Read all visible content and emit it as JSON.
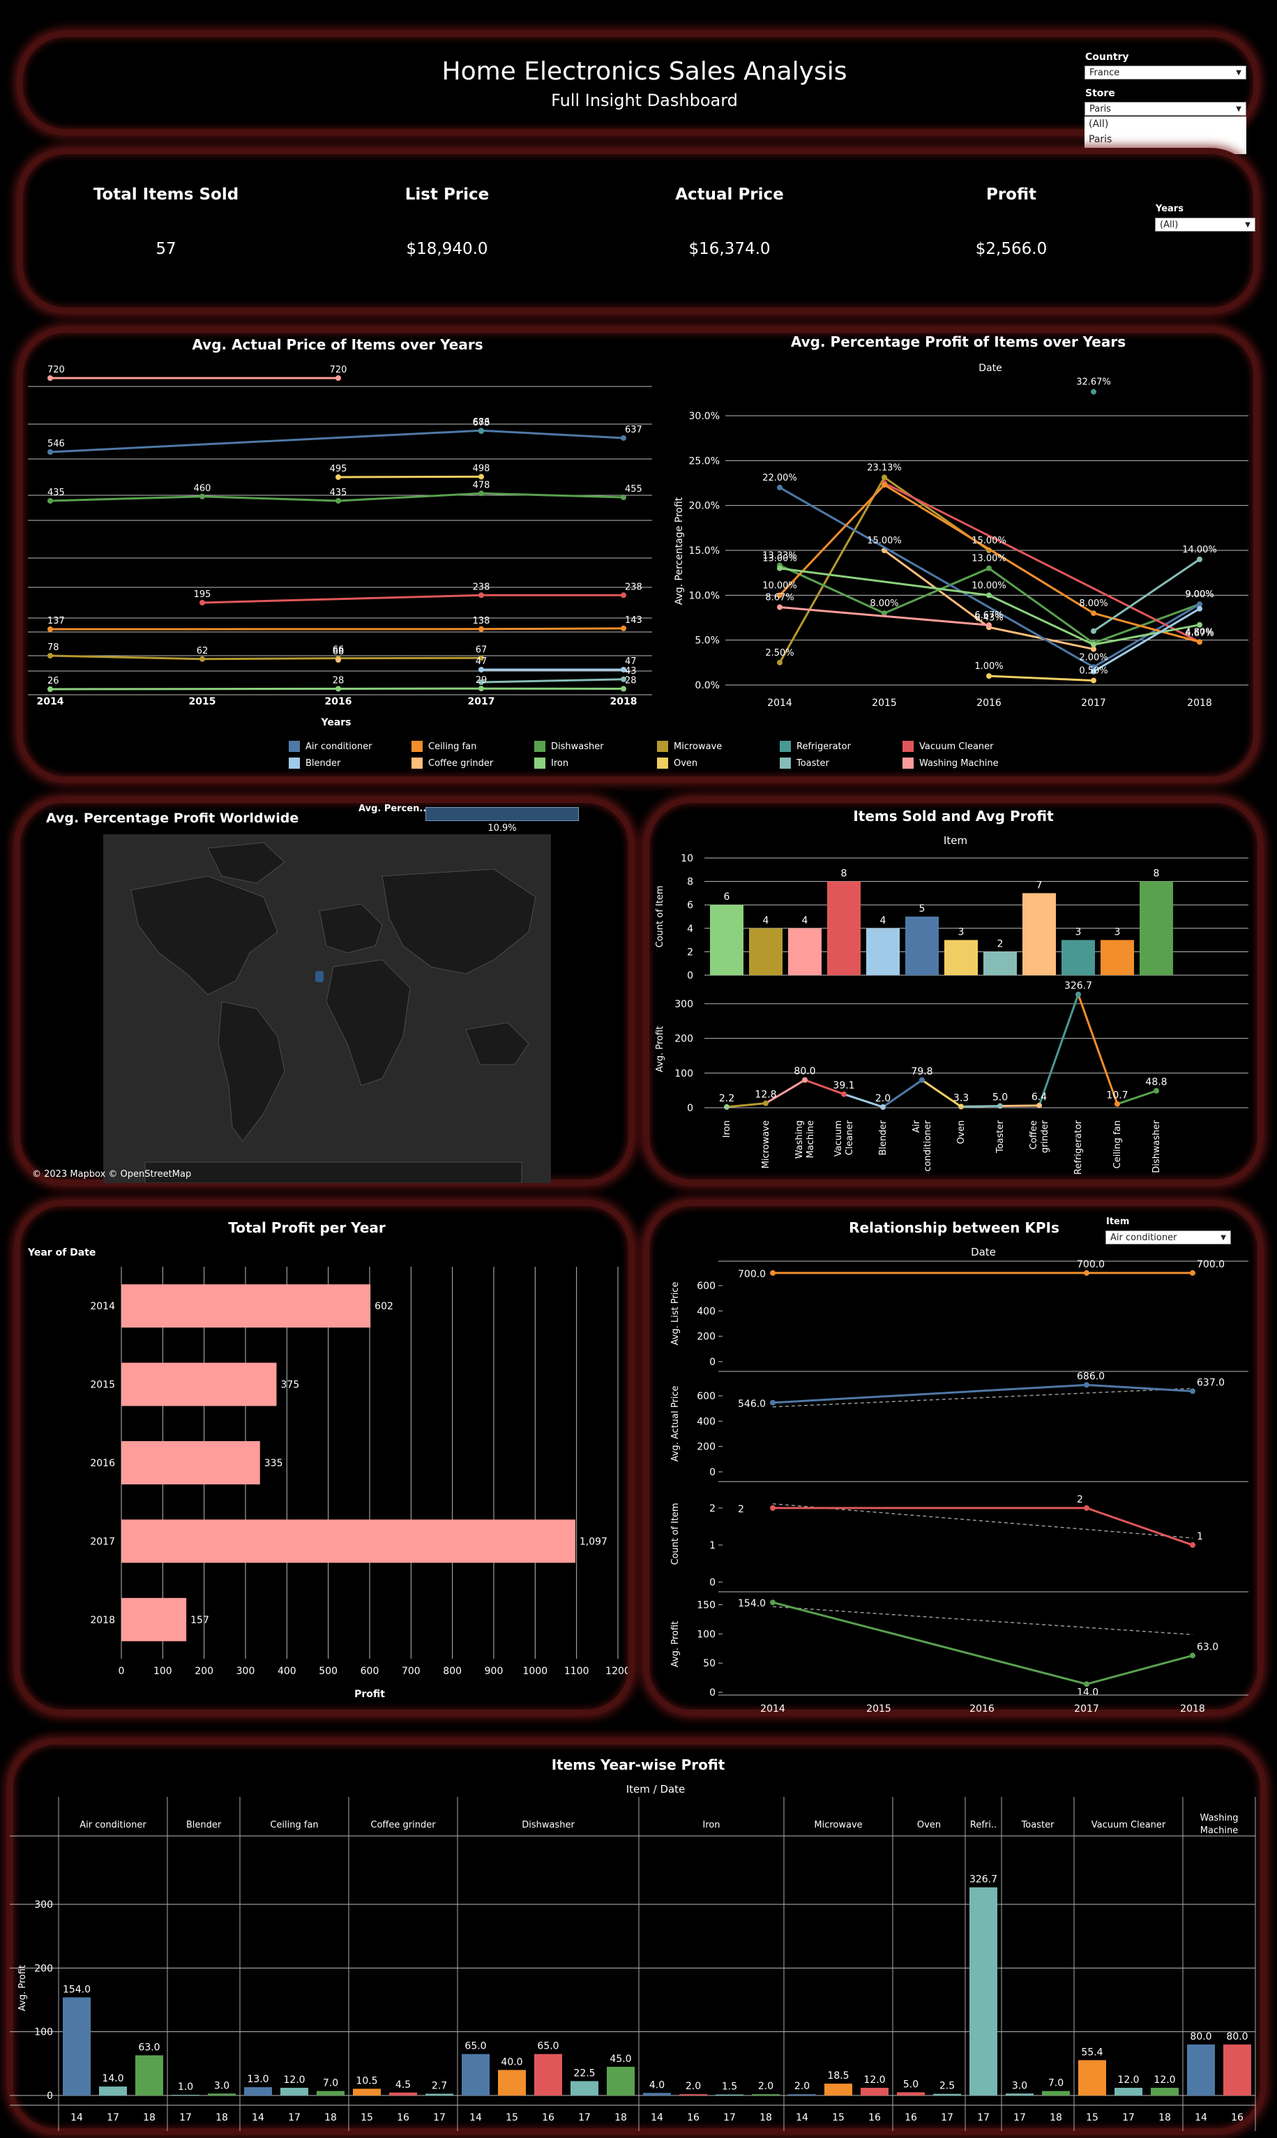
{
  "header": {
    "title": "Home Electronics Sales Analysis",
    "subtitle": "Full Insight Dashboard"
  },
  "filters": {
    "country_label": "Country",
    "country_value": "France",
    "store_label": "Store",
    "store_value": "Paris",
    "store_options": [
      "(All)",
      "Paris"
    ],
    "years_label": "Years",
    "years_value": "(All)"
  },
  "kpis": [
    {
      "label": "Total Items Sold",
      "value": "57"
    },
    {
      "label": "List Price",
      "value": "$18,940.0"
    },
    {
      "label": "Actual Price",
      "value": "$16,374.0"
    },
    {
      "label": "Profit",
      "value": "$2,566.0"
    }
  ],
  "colors": {
    "Air conditioner": "#4e79a7",
    "Blender": "#a0cbe8",
    "Ceiling fan": "#f28e2b",
    "Coffee grinder": "#ffbe7d",
    "Dishwasher": "#59a14f",
    "Iron": "#8cd17d",
    "Microwave": "#b6992d",
    "Oven": "#f1ce63",
    "Refrigerator": "#499894",
    "Toaster": "#86bcb6",
    "Vacuum Cleaner": "#e15759",
    "Washing Machine": "#ff9d9a",
    "panel_border": "#4a1010",
    "bar_pink": "#ff9d9a"
  },
  "legend": [
    "Air conditioner",
    "Ceiling fan",
    "Dishwasher",
    "Microwave",
    "Refrigerator",
    "Vacuum Cleaner",
    "Blender",
    "Coffee grinder",
    "Iron",
    "Oven",
    "Toaster",
    "Washing Machine"
  ],
  "avg_price_chart": {
    "title": "Avg. Actual Price of Items over Years",
    "xlabel": "Years",
    "years": [
      "2014",
      "2015",
      "2016",
      "2017",
      "2018"
    ],
    "series": [
      {
        "name": "Washing Machine",
        "values": [
          720,
          null,
          720,
          null,
          null
        ],
        "labels": [
          "720",
          "",
          "720",
          "",
          ""
        ]
      },
      {
        "name": "Air conditioner",
        "values": [
          546,
          null,
          null,
          686,
          637
        ],
        "labels": [
          "546",
          "",
          "",
          "686",
          "637"
        ]
      },
      {
        "name": "Refrigerator",
        "values": [
          null,
          null,
          null,
          673,
          null
        ],
        "labels": [
          "",
          "",
          "",
          "673",
          ""
        ]
      },
      {
        "name": "Oven",
        "values": [
          null,
          null,
          495,
          498,
          null
        ],
        "labels": [
          "",
          "",
          "495",
          "498",
          ""
        ]
      },
      {
        "name": "Dishwasher",
        "values": [
          435,
          460,
          435,
          478,
          455
        ],
        "labels": [
          "435",
          "460",
          "435",
          "478",
          "455"
        ]
      },
      {
        "name": "Vacuum Cleaner",
        "values": [
          null,
          195,
          null,
          238,
          238
        ],
        "labels": [
          "",
          "195",
          "",
          "238",
          "238"
        ]
      },
      {
        "name": "Ceiling fan",
        "values": [
          137,
          null,
          null,
          138,
          143
        ],
        "labels": [
          "137",
          "",
          "",
          "138",
          "143"
        ]
      },
      {
        "name": "Microwave",
        "values": [
          78,
          62,
          66,
          67,
          null
        ],
        "labels": [
          "78",
          "62",
          "66",
          "67",
          ""
        ]
      },
      {
        "name": "Coffee grinder",
        "values": [
          null,
          null,
          68,
          null,
          null
        ],
        "labels": [
          "",
          "",
          "68",
          "",
          ""
        ]
      },
      {
        "name": "Blender",
        "values": [
          null,
          null,
          null,
          47,
          47
        ],
        "labels": [
          "",
          "",
          "",
          "47",
          "47"
        ]
      },
      {
        "name": "Toaster",
        "values": [
          null,
          null,
          null,
          29,
          43
        ],
        "labels": [
          "",
          "",
          "",
          "",
          "43"
        ]
      },
      {
        "name": "Iron",
        "values": [
          26,
          null,
          28,
          29,
          28
        ],
        "labels": [
          "26",
          "",
          "28",
          "29",
          "28"
        ]
      }
    ]
  },
  "pct_profit_chart": {
    "title": "Avg. Percentage Profit of Items over Years",
    "header": "Date",
    "ylabel": "Avg. Percentage Profit",
    "yticks": [
      "0.0%",
      "5.0%",
      "10.0%",
      "15.0%",
      "20.0%",
      "25.0%",
      "30.0%"
    ],
    "years": [
      "2014",
      "2015",
      "2016",
      "2017",
      "2018"
    ],
    "series": [
      {
        "name": "Microwave",
        "values": [
          2.5,
          23.13,
          15.0,
          null,
          null
        ]
      },
      {
        "name": "Coffee grinder",
        "values": [
          null,
          15.0,
          6.43,
          4.0,
          null
        ]
      },
      {
        "name": "Dishwasher",
        "values": [
          13.33,
          8.0,
          13.0,
          4.67,
          9.0
        ]
      },
      {
        "name": "Oven",
        "values": [
          null,
          null,
          1.0,
          0.5,
          null
        ]
      },
      {
        "name": "Air conditioner",
        "values": [
          22.0,
          null,
          null,
          2.0,
          9.0
        ]
      },
      {
        "name": "Vacuum Cleaner",
        "values": [
          null,
          22.5,
          null,
          null,
          4.8
        ]
      },
      {
        "name": "Ceiling fan",
        "values": [
          10.0,
          22.3,
          null,
          8.0,
          4.8
        ]
      },
      {
        "name": "Iron",
        "values": [
          13.0,
          null,
          10.0,
          4.5,
          6.7
        ]
      },
      {
        "name": "Toaster",
        "values": [
          null,
          null,
          null,
          6.0,
          14.0
        ]
      },
      {
        "name": "Refrigerator",
        "values": [
          null,
          null,
          null,
          32.67,
          null
        ]
      },
      {
        "name": "Washing Machine",
        "values": [
          8.67,
          null,
          6.67,
          null,
          null
        ]
      },
      {
        "name": "Blender",
        "values": [
          null,
          null,
          null,
          1.5,
          8.5
        ]
      }
    ],
    "labels": [
      {
        "text": "32.67%",
        "x": "2017",
        "y": 32.67
      },
      {
        "text": "22.00%",
        "x": "2014",
        "y": 22.0
      },
      {
        "text": "23.13%",
        "x": "2015",
        "y": 23.13
      },
      {
        "text": "15.00%",
        "x": "2015",
        "y": 15.0
      },
      {
        "text": "15.00%",
        "x": "2016",
        "y": 15.0
      },
      {
        "text": "14.00%",
        "x": "2018",
        "y": 14.0
      },
      {
        "text": "13.33%",
        "x": "2014",
        "y": 13.33
      },
      {
        "text": "13.00%",
        "x": "2014",
        "y": 13.0
      },
      {
        "text": "13.00%",
        "x": "2016",
        "y": 13.0
      },
      {
        "text": "10.00%",
        "x": "2014",
        "y": 10.0
      },
      {
        "text": "10.00%",
        "x": "2016",
        "y": 10.0
      },
      {
        "text": "8.67%",
        "x": "2014",
        "y": 8.67
      },
      {
        "text": "8.00%",
        "x": "2015",
        "y": 8.0
      },
      {
        "text": "8.00%",
        "x": "2017",
        "y": 8.0
      },
      {
        "text": "9.00%",
        "x": "2018",
        "y": 9.0
      },
      {
        "text": "9.00%",
        "x": "2018",
        "y": 9.0
      },
      {
        "text": "6.67%",
        "x": "2016",
        "y": 6.67
      },
      {
        "text": "6.43%",
        "x": "2016",
        "y": 6.43
      },
      {
        "text": "4.67%",
        "x": "2018",
        "y": 4.67
      },
      {
        "text": "4.80%",
        "x": "2018",
        "y": 4.8
      },
      {
        "text": "2.50%",
        "x": "2014",
        "y": 2.5
      },
      {
        "text": "2.00%",
        "x": "2017",
        "y": 2.0
      },
      {
        "text": "1.00%",
        "x": "2016",
        "y": 1.0
      },
      {
        "text": "0.50%",
        "x": "2017",
        "y": 0.5
      }
    ]
  },
  "map_panel": {
    "title": "Avg. Percentage Profit Worldwide",
    "legend_label": "Avg. Percen...",
    "legend_value": "10.9%",
    "attribution": "© 2023 Mapbox  © OpenStreetMap"
  },
  "items_sold_chart": {
    "title": "Items Sold and Avg Profit",
    "header": "Item",
    "ylabel_top": "Count of Item",
    "ylabel_bottom": "Avg. Profit",
    "items": [
      "Iron",
      "Microwave",
      "Washing Machine",
      "Vacuum Cleaner",
      "Blender",
      "Air conditioner",
      "Oven",
      "Toaster",
      "Coffee grinder",
      "Refrigerator",
      "Ceiling fan",
      "Dishwasher"
    ],
    "item_labels": [
      [
        "Iron"
      ],
      [
        "Microwave"
      ],
      [
        "Washing",
        "Machine"
      ],
      [
        "Vacuum",
        "Cleaner"
      ],
      [
        "Blender"
      ],
      [
        "Air",
        "conditioner"
      ],
      [
        "Oven"
      ],
      [
        "Toaster"
      ],
      [
        "Coffee",
        "grinder"
      ],
      [
        "Refrigerator"
      ],
      [
        "Ceiling fan"
      ],
      [
        "Dishwasher"
      ]
    ],
    "counts": [
      6,
      4,
      4,
      8,
      4,
      5,
      3,
      2,
      7,
      3,
      3,
      8
    ],
    "count_ticks": [
      "0",
      "2",
      "4",
      "6",
      "8",
      "10"
    ],
    "profits": [
      2.2,
      12.8,
      80.0,
      39.1,
      2.0,
      79.8,
      3.3,
      5.0,
      6.4,
      326.7,
      10.7,
      48.8
    ],
    "profit_labels": [
      "2.2",
      "12.8",
      "80.0",
      "39.1",
      "2.0",
      "79.8",
      "3.3",
      "5.0",
      "6.4",
      "326.7",
      "10.7",
      "48.8"
    ],
    "profit_ticks": [
      "0",
      "100",
      "200",
      "300"
    ]
  },
  "profit_year_chart": {
    "title": "Total Profit per Year",
    "row_header": "Year of Date",
    "xlabel": "Profit",
    "years": [
      "2014",
      "2015",
      "2016",
      "2017",
      "2018"
    ],
    "values": [
      602,
      375,
      335,
      1097,
      157
    ],
    "labels": [
      "602",
      "375",
      "335",
      "1,097",
      "157"
    ],
    "xticks": [
      "0",
      "100",
      "200",
      "300",
      "400",
      "500",
      "600",
      "700",
      "800",
      "900",
      "1000",
      "1100",
      "1200"
    ]
  },
  "kpi_relation_chart": {
    "title": "Relationship between KPIs",
    "header": "Date",
    "item_label": "Item",
    "item_value": "Air conditioner",
    "years": [
      "2014",
      "2015",
      "2016",
      "2017",
      "2018"
    ],
    "panes": [
      {
        "ylabel": "Avg. List Price",
        "ticks": [
          "0",
          "200",
          "400",
          "600"
        ],
        "max": 760,
        "values": [
          700,
          null,
          null,
          700,
          700
        ],
        "labels": [
          "700.0",
          "",
          "",
          "700.0",
          "700.0"
        ]
      },
      {
        "ylabel": "Avg. Actual Price",
        "ticks": [
          "0",
          "200",
          "400",
          "600"
        ],
        "max": 760,
        "values": [
          546,
          null,
          null,
          686,
          637
        ],
        "labels": [
          "546.0",
          "",
          "",
          "686.0",
          "637.0"
        ]
      },
      {
        "ylabel": "Count of Item",
        "ticks": [
          "0",
          "1",
          "2"
        ],
        "max": 2.6,
        "values": [
          2,
          null,
          null,
          2,
          1
        ],
        "labels": [
          "2",
          "",
          "",
          "2",
          "1"
        ]
      },
      {
        "ylabel": "Avg. Profit",
        "ticks": [
          "0",
          "50",
          "100",
          "150"
        ],
        "max": 165,
        "values": [
          154,
          null,
          null,
          14,
          63
        ],
        "labels": [
          "154.0",
          "",
          "",
          "14.0",
          "63.0"
        ]
      }
    ]
  },
  "yearwise_chart": {
    "title": "Items Year-wise Profit",
    "header": "Item / Date",
    "ylabel": "Avg. Profit",
    "yticks": [
      "0",
      "100",
      "200",
      "300"
    ],
    "groups": [
      {
        "name": "Air conditioner",
        "bars": [
          [
            "14",
            154.0,
            "154.0"
          ],
          [
            "17",
            14.0,
            "14.0"
          ],
          [
            "18",
            63.0,
            "63.0"
          ]
        ]
      },
      {
        "name": "Blender",
        "bars": [
          [
            "17",
            1.0,
            "1.0"
          ],
          [
            "18",
            3.0,
            "3.0"
          ]
        ]
      },
      {
        "name": "Ceiling fan",
        "bars": [
          [
            "14",
            13.0,
            "13.0"
          ],
          [
            "17",
            12.0,
            "12.0"
          ],
          [
            "18",
            7.0,
            "7.0"
          ]
        ]
      },
      {
        "name": "Coffee grinder",
        "bars": [
          [
            "15",
            10.5,
            "10.5"
          ],
          [
            "16",
            4.5,
            "4.5"
          ],
          [
            "17",
            2.7,
            "2.7"
          ]
        ]
      },
      {
        "name": "Dishwasher",
        "bars": [
          [
            "14",
            65.0,
            "65.0"
          ],
          [
            "15",
            40.0,
            "40.0"
          ],
          [
            "16",
            65.0,
            "65.0"
          ],
          [
            "17",
            22.5,
            "22.5"
          ],
          [
            "18",
            45.0,
            "45.0"
          ]
        ]
      },
      {
        "name": "Iron",
        "bars": [
          [
            "14",
            4.0,
            "4.0"
          ],
          [
            "16",
            2.0,
            "2.0"
          ],
          [
            "17",
            1.5,
            "1.5"
          ],
          [
            "18",
            2.0,
            "2.0"
          ]
        ]
      },
      {
        "name": "Microwave",
        "bars": [
          [
            "14",
            2.0,
            "2.0"
          ],
          [
            "15",
            18.5,
            "18.5"
          ],
          [
            "16",
            12.0,
            "12.0"
          ]
        ]
      },
      {
        "name": "Oven",
        "bars": [
          [
            "16",
            5.0,
            "5.0"
          ],
          [
            "17",
            2.5,
            "2.5"
          ]
        ]
      },
      {
        "name": "Refri..",
        "bars": [
          [
            "17",
            326.7,
            "326.7"
          ]
        ]
      },
      {
        "name": "Toaster",
        "bars": [
          [
            "17",
            3.0,
            "3.0"
          ],
          [
            "18",
            7.0,
            "7.0"
          ]
        ]
      },
      {
        "name": "Vacuum Cleaner",
        "bars": [
          [
            "15",
            55.4,
            "55.4"
          ],
          [
            "17",
            12.0,
            "12.0"
          ],
          [
            "18",
            12.0,
            "12.0"
          ]
        ]
      },
      {
        "name": "Washing Machine",
        "bars": [
          [
            "14",
            80.0,
            "80.0"
          ],
          [
            "16",
            80.0,
            "80.0"
          ]
        ]
      }
    ],
    "year_colors": {
      "14": "#4e79a7",
      "15": "#f28e2b",
      "16": "#e15759",
      "17": "#76b7b2",
      "18": "#59a14f"
    }
  }
}
